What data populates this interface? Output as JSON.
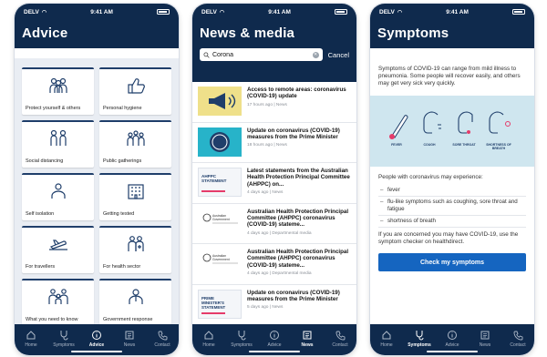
{
  "status": {
    "carrier": "DELV",
    "time": "9:41 AM"
  },
  "advice": {
    "title": "Advice",
    "tiles": [
      {
        "label": "Protect yourself & others",
        "icon": "group-icon"
      },
      {
        "label": "Personal hygiene",
        "icon": "thumbs-up-icon"
      },
      {
        "label": "Social distancing",
        "icon": "two-people-icon"
      },
      {
        "label": "Public gatherings",
        "icon": "crowd-icon"
      },
      {
        "label": "Self isolation",
        "icon": "person-icon"
      },
      {
        "label": "Getting tested",
        "icon": "building-icon"
      },
      {
        "label": "For travellers",
        "icon": "plane-icon"
      },
      {
        "label": "For health sector",
        "icon": "health-worker-icon"
      },
      {
        "label": "What you need to know",
        "icon": "family-icon"
      },
      {
        "label": "Government response",
        "icon": "government-icon"
      }
    ]
  },
  "news": {
    "title": "News & media",
    "search_value": "Corona",
    "cancel_label": "Cancel",
    "items": [
      {
        "headline": "Access to remote areas: coronavirus (COVID-19) update",
        "meta": "17 hours ago | News",
        "thumb": "megaphone"
      },
      {
        "headline": "Update on coronavirus (COVID-19) measures from the Prime Minister",
        "meta": "18 hours ago | News",
        "thumb": "stop-spread"
      },
      {
        "headline": "Latest statements from the Australian Health Protection Principal Committee (AHPPC) on...",
        "meta": "4 days ago | News",
        "thumb": "ahppc",
        "thumb_text": "AHPPC STATEMENT"
      },
      {
        "headline": "Australian Health Protection Principal Committee (AHPPC) coronavirus (COVID-19) stateme...",
        "meta": "4 days ago | Departmental media",
        "thumb": "govt",
        "thumb_text": "Australian Government"
      },
      {
        "headline": "Australian Health Protection Principal Committee (AHPPC) coronavirus (COVID-19) stateme...",
        "meta": "4 days ago | Departmental media",
        "thumb": "govt",
        "thumb_text": "Australian Government"
      },
      {
        "headline": "Update on coronavirus (COVID-19) measures from the Prime Minister",
        "meta": "5 days ago | News",
        "thumb": "pm",
        "thumb_text": "PRIME MINISTER'S STATEMENT"
      }
    ]
  },
  "symptoms": {
    "title": "Symptoms",
    "intro": "Symptoms of COVID-19 can range from mild illness to pneumonia. Some people will recover easily, and others may get very sick very quickly.",
    "image_captions": [
      "FEVER",
      "COUGH",
      "SORE THROAT",
      "SHORTNESS OF BREATH"
    ],
    "list_intro": "People with coronavirus may experience:",
    "list": [
      "fever",
      "flu-like symptoms such as coughing, sore throat and fatigue",
      "shortness of breath"
    ],
    "outro": "If you are concerned you may have COVID-19, use the symptom checker on healthdirect.",
    "button_label": "Check my symptoms"
  },
  "tabs": [
    {
      "label": "Home",
      "icon": "home-icon"
    },
    {
      "label": "Symptoms",
      "icon": "stethoscope-icon"
    },
    {
      "label": "Advice",
      "icon": "info-icon"
    },
    {
      "label": "News",
      "icon": "newspaper-icon"
    },
    {
      "label": "Contact",
      "icon": "phone-icon"
    }
  ],
  "active_tab": {
    "advice": "Advice",
    "news": "News",
    "symptoms": "Symptoms"
  },
  "colors": {
    "navy": "#0f2a4d",
    "accent_blue": "#1565c0",
    "grid_bg": "#e9edf3"
  }
}
